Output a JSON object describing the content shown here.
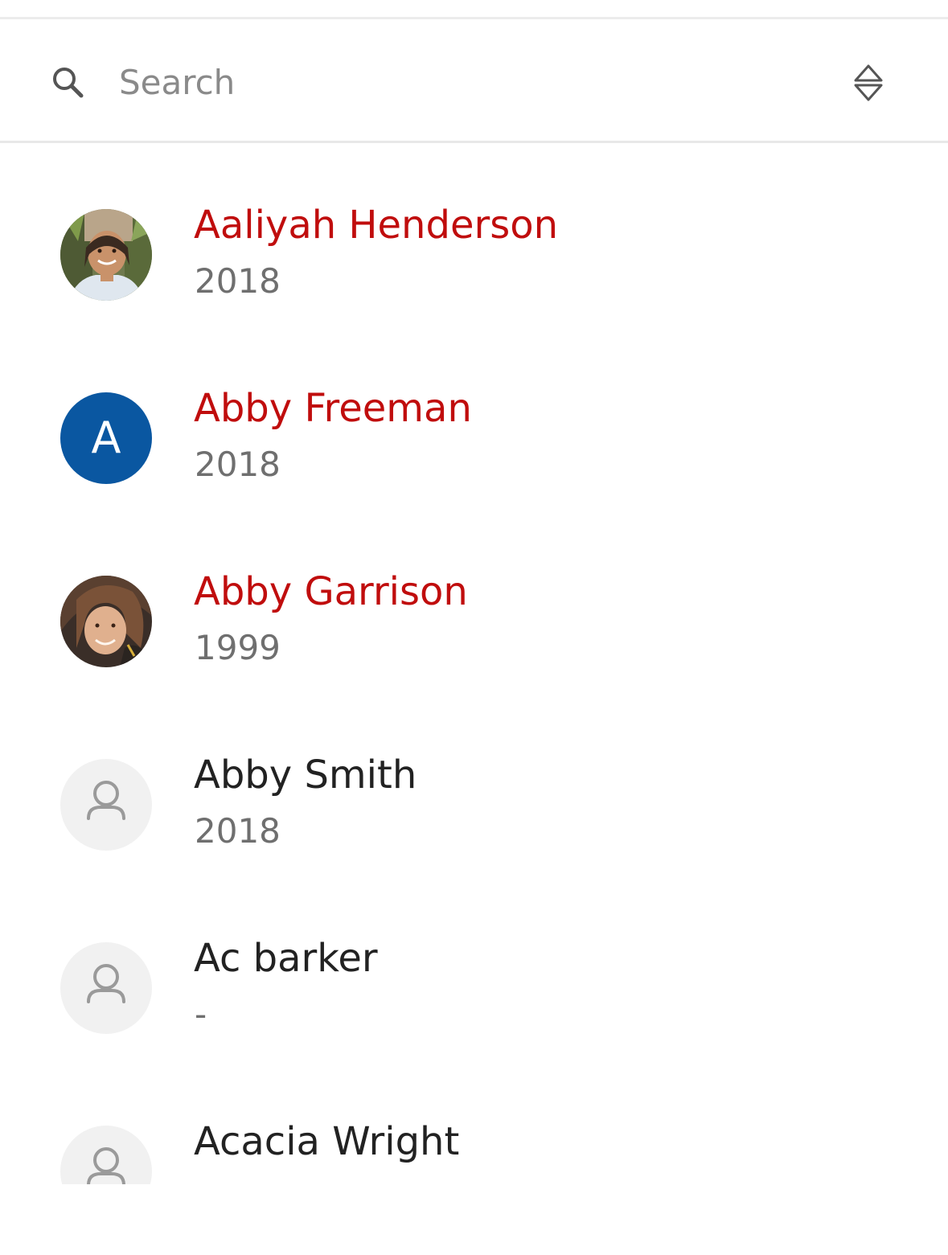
{
  "search": {
    "placeholder": "Search",
    "value": ""
  },
  "icons": {
    "search": "search-icon",
    "sort": "sort-icon",
    "person": "person-icon"
  },
  "colors": {
    "highlight_name": "#c00d0d",
    "normal_name": "#222222",
    "subtitle": "#6f6f6f",
    "letter_avatar_bg": "#0a57a1",
    "placeholder_avatar_bg": "#f1f1f1"
  },
  "contacts": [
    {
      "name": "Aaliyah Henderson",
      "year": "2018",
      "avatar": "photo",
      "highlighted": true
    },
    {
      "name": "Abby Freeman",
      "year": "2018",
      "avatar": "letter",
      "initial": "A",
      "highlighted": true
    },
    {
      "name": "Abby Garrison",
      "year": "1999",
      "avatar": "photo",
      "highlighted": true
    },
    {
      "name": "Abby Smith",
      "year": "2018",
      "avatar": "placeholder",
      "highlighted": false
    },
    {
      "name": "Ac barker",
      "year": "-",
      "avatar": "placeholder",
      "highlighted": false
    },
    {
      "name": "Acacia Wright",
      "year": "",
      "avatar": "placeholder",
      "highlighted": false
    }
  ]
}
